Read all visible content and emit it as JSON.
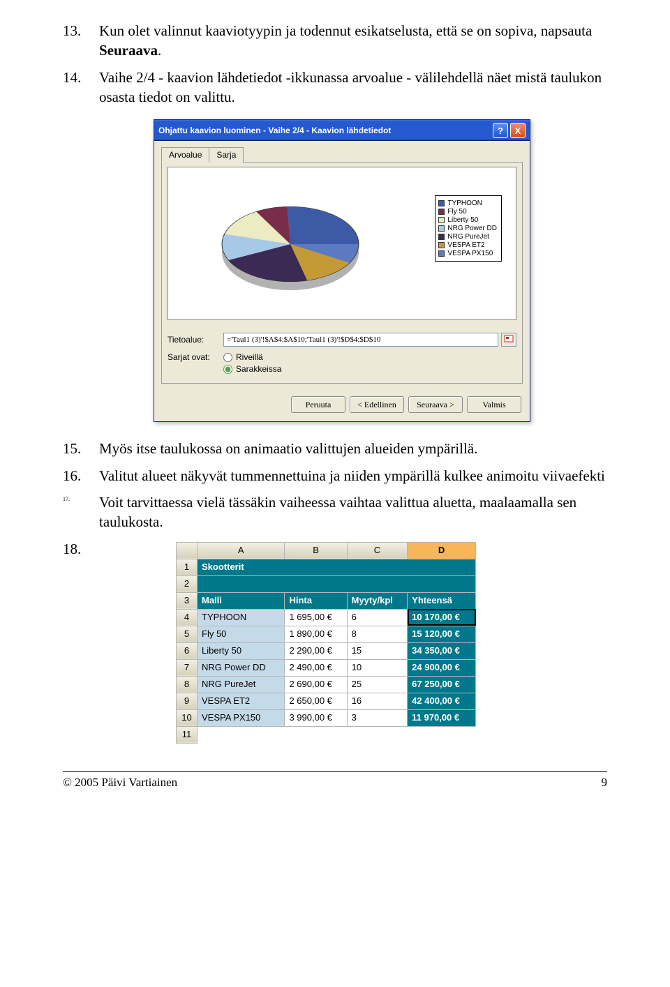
{
  "steps": {
    "s13": {
      "num": "13.",
      "text_a": "Kun olet valinnut kaaviotyypin ja todennut esikatselusta, että se on sopiva, napsauta ",
      "text_b": "Seuraava",
      "text_c": "."
    },
    "s14": {
      "num": "14.",
      "text": "Vaihe 2/4 - kaavion lähdetiedot -ikkunassa arvoalue - välilehdellä näet mistä taulukon osasta tiedot on valittu."
    },
    "s15": {
      "num": "15.",
      "text": "Myös itse taulukossa on animaatio valittujen alueiden ympärillä."
    },
    "s16": {
      "num": "16.",
      "text": "Valitut alueet näkyvät tummennettuina ja niiden ympärillä kulkee animoitu viivaefekti"
    },
    "s17": {
      "num": "17.",
      "text": "Voit tarvittaessa vielä tässäkin vaiheessa vaihtaa valittua aluetta, maalaamalla sen taulukosta."
    },
    "s18": {
      "num": "18."
    }
  },
  "dialog": {
    "title": "Ohjattu kaavion luominen - Vaihe 2/4 - Kaavion lähdetiedot",
    "help": "?",
    "close": "X",
    "tabs": {
      "arvoalue": "Arvoalue",
      "sarja": "Sarja"
    },
    "legend": [
      {
        "color": "#3c5aa6",
        "label": "TYPHOON"
      },
      {
        "color": "#7a2d4a",
        "label": "Fly 50"
      },
      {
        "color": "#edebc1",
        "label": "Liberty 50"
      },
      {
        "color": "#a7c9e8",
        "label": "NRG Power DD"
      },
      {
        "color": "#3b2a53",
        "label": "NRG PureJet"
      },
      {
        "color": "#c49a37",
        "label": "VESPA ET2"
      },
      {
        "color": "#5d7ac0",
        "label": "VESPA PX150"
      }
    ],
    "range_label": "Tietoalue:",
    "range_value": "='Taul1 (3)'!$A$4:$A$10;'Taul1 (3)'!$D$4:$D$10",
    "series_label": "Sarjat ovat:",
    "radio_rows": "Riveillä",
    "radio_cols": "Sarakkeissa",
    "btn_cancel": "Peruuta",
    "btn_back": "< Edellinen",
    "btn_next": "Seuraava >",
    "btn_finish": "Valmis"
  },
  "sheet": {
    "cols": {
      "corner": "",
      "A": "A",
      "B": "B",
      "C": "C",
      "D": "D"
    },
    "title": "Skootterit",
    "headers": {
      "A": "Malli",
      "B": "Hinta",
      "C": "Myyty/kpl",
      "D": "Yhteensä"
    },
    "rows": [
      {
        "n": "4",
        "A": "TYPHOON",
        "B": "1 695,00 €",
        "C": "6",
        "D": "10 170,00 €"
      },
      {
        "n": "5",
        "A": "Fly 50",
        "B": "1 890,00 €",
        "C": "8",
        "D": "15 120,00 €"
      },
      {
        "n": "6",
        "A": "Liberty 50",
        "B": "2 290,00 €",
        "C": "15",
        "D": "34 350,00 €"
      },
      {
        "n": "7",
        "A": "NRG Power DD",
        "B": "2 490,00 €",
        "C": "10",
        "D": "24 900,00 €"
      },
      {
        "n": "8",
        "A": "NRG PureJet",
        "B": "2 690,00 €",
        "C": "25",
        "D": "67 250,00 €"
      },
      {
        "n": "9",
        "A": "VESPA ET2",
        "B": "2 650,00 €",
        "C": "16",
        "D": "42 400,00 €"
      },
      {
        "n": "10",
        "A": "VESPA PX150",
        "B": "3 990,00 €",
        "C": "3",
        "D": "11 970,00 €"
      }
    ],
    "extra_row": "11"
  },
  "chart_data": {
    "type": "pie",
    "title": "",
    "series": [
      {
        "name": "Yhteensä",
        "categories": [
          "TYPHOON",
          "Fly 50",
          "Liberty 50",
          "NRG Power DD",
          "NRG PureJet",
          "VESPA ET2",
          "VESPA PX150"
        ],
        "values": [
          10170,
          15120,
          34350,
          24900,
          67250,
          42400,
          11970
        ]
      }
    ]
  },
  "footer": {
    "copyright": "© 2005 Päivi Vartiainen",
    "page": "9"
  }
}
